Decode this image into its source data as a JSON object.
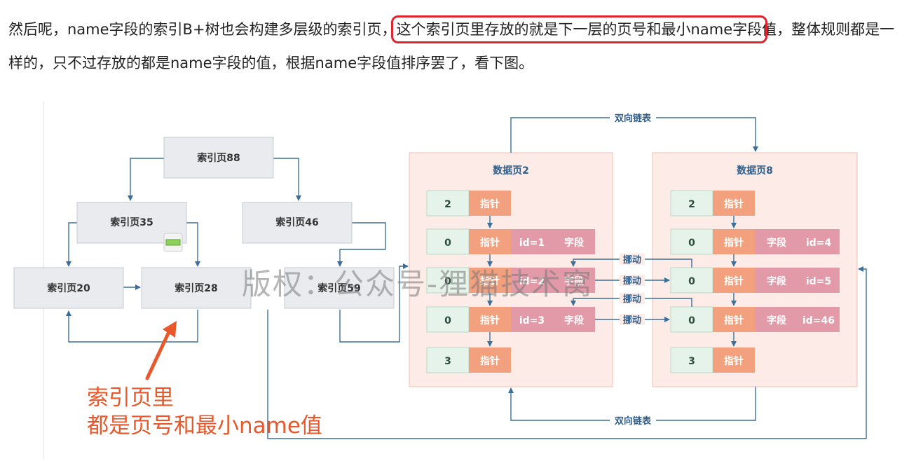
{
  "paragraph": {
    "before": "然后呢，name字段的索引B+树也会构建多层级的索引页，",
    "highlight": "这个索引页里存放的就是下一层的页号和最小name字段",
    "after": "值，整体规则都是一样的，只不过存放的都是name字段的值，根据name字段值排序罢了，看下图。"
  },
  "diagram": {
    "index_pages": {
      "p88": "索引页88",
      "p35": "索引页35",
      "p46": "索引页46",
      "p20": "索引页20",
      "p28": "索引页28",
      "p59": "索引页59"
    },
    "link_label": "双向链表",
    "move_label": "挪动",
    "page2": {
      "title": "数据页2",
      "rows": [
        {
          "num": "2",
          "ptr": "指针",
          "c1": "",
          "c2": ""
        },
        {
          "num": "0",
          "ptr": "指针",
          "c1": "id=1",
          "c2": "字段"
        },
        {
          "num": "0",
          "ptr": "指针",
          "c1": "id=2",
          "c2": "字段"
        },
        {
          "num": "0",
          "ptr": "指针",
          "c1": "id=3",
          "c2": "字段"
        },
        {
          "num": "3",
          "ptr": "指针",
          "c1": "",
          "c2": ""
        }
      ]
    },
    "page8": {
      "title": "数据页8",
      "rows": [
        {
          "num": "2",
          "ptr": "指针",
          "c1": "",
          "c2": ""
        },
        {
          "num": "0",
          "ptr": "指针",
          "c1": "字段",
          "c2": "id=4"
        },
        {
          "num": "0",
          "ptr": "指针",
          "c1": "字段",
          "c2": "id=5"
        },
        {
          "num": "0",
          "ptr": "指针",
          "c1": "字段",
          "c2": "id=46"
        },
        {
          "num": "3",
          "ptr": "指针",
          "c1": "",
          "c2": ""
        }
      ]
    }
  },
  "annotation": {
    "line1": "索引页里",
    "line2": "都是页号和最小name值"
  },
  "watermark": "版权：公众号-狸猫技术窝",
  "colors": {
    "highlight_border": "#e0242f",
    "index_fill": "#e9ebef",
    "data_page_fill": "#fcebe6",
    "num_cell": "#e6f3ea",
    "ptr_cell": "#f2a07e",
    "field_cell": "#e39aa8",
    "arrow": "#3b6f99",
    "annotation": "#e8582a"
  }
}
